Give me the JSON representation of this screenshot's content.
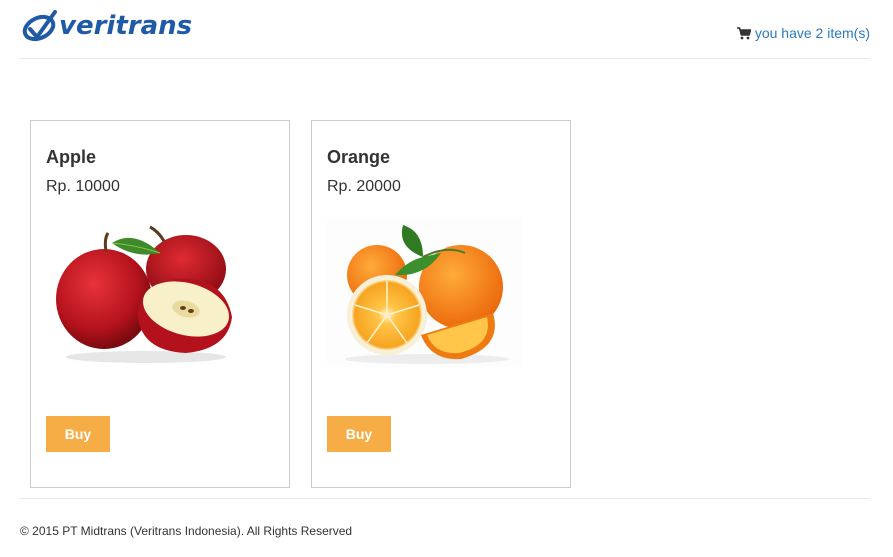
{
  "header": {
    "logo_text": "veritrans",
    "cart_text": "you have 2 item(s)",
    "cart_icon": "shopping-cart-icon",
    "brand_color": "#1f5aa6",
    "link_color": "#2a7ac0"
  },
  "products": [
    {
      "title": "Apple",
      "price": "Rp. 10000",
      "buy_label": "Buy",
      "image": "apple-image"
    },
    {
      "title": "Orange",
      "price": "Rp. 20000",
      "buy_label": "Buy",
      "image": "orange-image"
    }
  ],
  "button_color": "#f7ad45",
  "footer": {
    "copyright": "© 2015 PT Midtrans (Veritrans Indonesia). All Rights Reserved"
  }
}
